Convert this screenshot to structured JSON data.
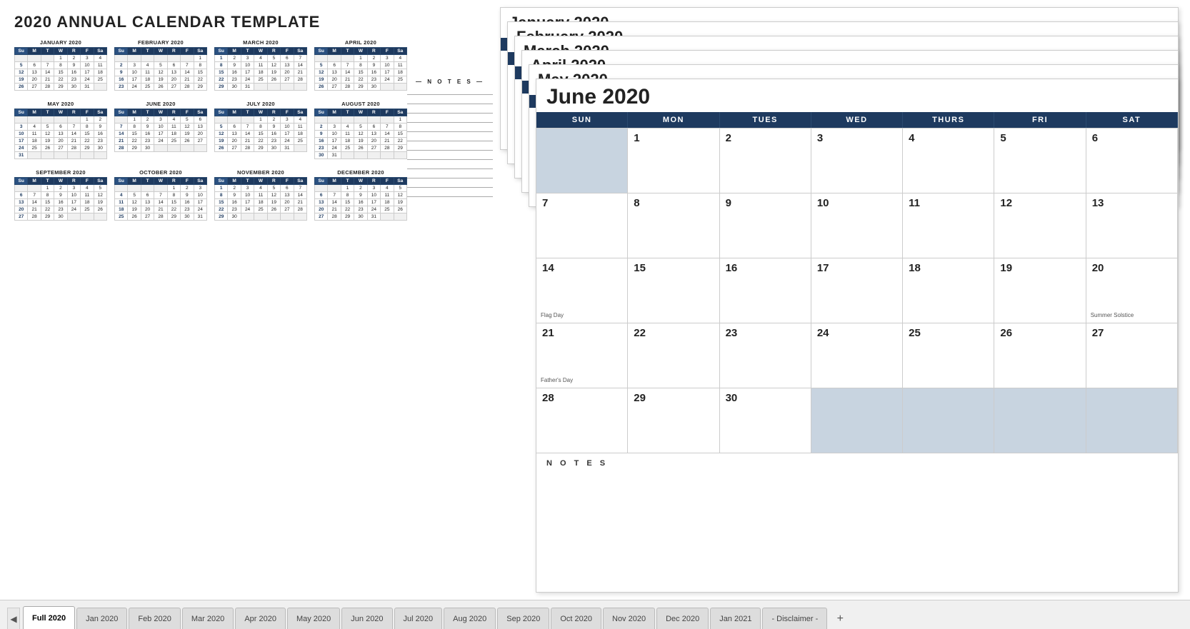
{
  "page": {
    "title": "2020 ANNUAL CALENDAR TEMPLATE"
  },
  "mini_calendars": [
    {
      "name": "JANUARY 2020",
      "headers": [
        "Su",
        "M",
        "T",
        "W",
        "R",
        "F",
        "Sa"
      ],
      "rows": [
        [
          "",
          "",
          "",
          "1",
          "2",
          "3",
          "4"
        ],
        [
          "5",
          "6",
          "7",
          "8",
          "9",
          "10",
          "11"
        ],
        [
          "12",
          "13",
          "14",
          "15",
          "16",
          "17",
          "18"
        ],
        [
          "19",
          "20",
          "21",
          "22",
          "23",
          "24",
          "25"
        ],
        [
          "26",
          "27",
          "28",
          "29",
          "30",
          "31",
          ""
        ]
      ]
    },
    {
      "name": "FEBRUARY 2020",
      "headers": [
        "Su",
        "M",
        "T",
        "W",
        "R",
        "F",
        "Sa"
      ],
      "rows": [
        [
          "",
          "",
          "",
          "",
          "",
          "",
          "1"
        ],
        [
          "2",
          "3",
          "4",
          "5",
          "6",
          "7",
          "8"
        ],
        [
          "9",
          "10",
          "11",
          "12",
          "13",
          "14",
          "15"
        ],
        [
          "16",
          "17",
          "18",
          "19",
          "20",
          "21",
          "22"
        ],
        [
          "23",
          "24",
          "25",
          "26",
          "27",
          "28",
          "29"
        ]
      ]
    },
    {
      "name": "MARCH 2020",
      "headers": [
        "Su",
        "M",
        "T",
        "W",
        "R",
        "F",
        "Sa"
      ],
      "rows": [
        [
          "1",
          "2",
          "3",
          "4",
          "5",
          "6",
          "7"
        ],
        [
          "8",
          "9",
          "10",
          "11",
          "12",
          "13",
          "14"
        ],
        [
          "15",
          "16",
          "17",
          "18",
          "19",
          "20",
          "21"
        ],
        [
          "22",
          "23",
          "24",
          "25",
          "26",
          "27",
          "28"
        ],
        [
          "29",
          "30",
          "31",
          "",
          "",
          "",
          ""
        ]
      ]
    },
    {
      "name": "APRIL 2020",
      "headers": [
        "Su",
        "M",
        "T",
        "W",
        "R",
        "F",
        "Sa"
      ],
      "rows": [
        [
          "",
          "",
          "",
          "1",
          "2",
          "3",
          "4"
        ],
        [
          "5",
          "6",
          "7",
          "8",
          "9",
          "10",
          "11"
        ],
        [
          "12",
          "13",
          "14",
          "15",
          "16",
          "17",
          "18"
        ],
        [
          "19",
          "20",
          "21",
          "22",
          "23",
          "24",
          "25"
        ],
        [
          "26",
          "27",
          "28",
          "29",
          "30",
          "",
          ""
        ]
      ]
    },
    {
      "name": "MAY 2020",
      "headers": [
        "Su",
        "M",
        "T",
        "W",
        "R",
        "F",
        "Sa"
      ],
      "rows": [
        [
          "",
          "",
          "",
          "",
          "",
          "1",
          "2"
        ],
        [
          "3",
          "4",
          "5",
          "6",
          "7",
          "8",
          "9"
        ],
        [
          "10",
          "11",
          "12",
          "13",
          "14",
          "15",
          "16"
        ],
        [
          "17",
          "18",
          "19",
          "20",
          "21",
          "22",
          "23"
        ],
        [
          "24",
          "25",
          "26",
          "27",
          "28",
          "29",
          "30"
        ],
        [
          "31",
          "",
          "",
          "",
          "",
          "",
          ""
        ]
      ]
    },
    {
      "name": "JUNE 2020",
      "headers": [
        "Su",
        "M",
        "T",
        "W",
        "R",
        "F",
        "Sa"
      ],
      "rows": [
        [
          "",
          "1",
          "2",
          "3",
          "4",
          "5",
          "6"
        ],
        [
          "7",
          "8",
          "9",
          "10",
          "11",
          "12",
          "13"
        ],
        [
          "14",
          "15",
          "16",
          "17",
          "18",
          "19",
          "20"
        ],
        [
          "21",
          "22",
          "23",
          "24",
          "25",
          "26",
          "27"
        ],
        [
          "28",
          "29",
          "30",
          "",
          "",
          "",
          ""
        ]
      ]
    },
    {
      "name": "JULY 2020",
      "headers": [
        "Su",
        "M",
        "T",
        "W",
        "R",
        "F",
        "Sa"
      ],
      "rows": [
        [
          "",
          "",
          "",
          "1",
          "2",
          "3",
          "4"
        ],
        [
          "5",
          "6",
          "7",
          "8",
          "9",
          "10",
          "11"
        ],
        [
          "12",
          "13",
          "14",
          "15",
          "16",
          "17",
          "18"
        ],
        [
          "19",
          "20",
          "21",
          "22",
          "23",
          "24",
          "25"
        ],
        [
          "26",
          "27",
          "28",
          "29",
          "30",
          "31",
          ""
        ]
      ]
    },
    {
      "name": "AUGUST 2020",
      "headers": [
        "Su",
        "M",
        "T",
        "W",
        "R",
        "F",
        "Sa"
      ],
      "rows": [
        [
          "",
          "",
          "",
          "",
          "",
          "",
          "1"
        ],
        [
          "2",
          "3",
          "4",
          "5",
          "6",
          "7",
          "8"
        ],
        [
          "9",
          "10",
          "11",
          "12",
          "13",
          "14",
          "15"
        ],
        [
          "16",
          "17",
          "18",
          "19",
          "20",
          "21",
          "22"
        ],
        [
          "23",
          "24",
          "25",
          "26",
          "27",
          "28",
          "29"
        ],
        [
          "30",
          "31",
          "",
          "",
          "",
          "",
          ""
        ]
      ]
    },
    {
      "name": "SEPTEMBER 2020",
      "headers": [
        "Su",
        "M",
        "T",
        "W",
        "R",
        "F",
        "Sa"
      ],
      "rows": [
        [
          "",
          "",
          "1",
          "2",
          "3",
          "4",
          "5"
        ],
        [
          "6",
          "7",
          "8",
          "9",
          "10",
          "11",
          "12"
        ],
        [
          "13",
          "14",
          "15",
          "16",
          "17",
          "18",
          "19"
        ],
        [
          "20",
          "21",
          "22",
          "23",
          "24",
          "25",
          "26"
        ],
        [
          "27",
          "28",
          "29",
          "30",
          "",
          "",
          ""
        ]
      ]
    },
    {
      "name": "OCTOBER 2020",
      "headers": [
        "Su",
        "M",
        "T",
        "W",
        "R",
        "F",
        "Sa"
      ],
      "rows": [
        [
          "",
          "",
          "",
          "",
          "1",
          "2",
          "3"
        ],
        [
          "4",
          "5",
          "6",
          "7",
          "8",
          "9",
          "10"
        ],
        [
          "11",
          "12",
          "13",
          "14",
          "15",
          "16",
          "17"
        ],
        [
          "18",
          "19",
          "20",
          "21",
          "22",
          "23",
          "24"
        ],
        [
          "25",
          "26",
          "27",
          "28",
          "29",
          "30",
          "31"
        ]
      ]
    },
    {
      "name": "NOVEMBER 2020",
      "headers": [
        "Su",
        "M",
        "T",
        "W",
        "R",
        "F",
        "Sa"
      ],
      "rows": [
        [
          "1",
          "2",
          "3",
          "4",
          "5",
          "6",
          "7"
        ],
        [
          "8",
          "9",
          "10",
          "11",
          "12",
          "13",
          "14"
        ],
        [
          "15",
          "16",
          "17",
          "18",
          "19",
          "20",
          "21"
        ],
        [
          "22",
          "23",
          "24",
          "25",
          "26",
          "27",
          "28"
        ],
        [
          "29",
          "30",
          "",
          "",
          "",
          "",
          ""
        ]
      ]
    },
    {
      "name": "DECEMBER 2020",
      "headers": [
        "Su",
        "M",
        "T",
        "W",
        "R",
        "F",
        "Sa"
      ],
      "rows": [
        [
          "",
          "",
          "1",
          "2",
          "3",
          "4",
          "5"
        ],
        [
          "6",
          "7",
          "8",
          "9",
          "10",
          "11",
          "12"
        ],
        [
          "13",
          "14",
          "15",
          "16",
          "17",
          "18",
          "19"
        ],
        [
          "20",
          "21",
          "22",
          "23",
          "24",
          "25",
          "26"
        ],
        [
          "27",
          "28",
          "29",
          "30",
          "31",
          "",
          ""
        ]
      ]
    }
  ],
  "notes_label": "— N O T E S —",
  "stacked_months": [
    "January 2020",
    "February 2020",
    "March 2020",
    "April 2020",
    "May 2020"
  ],
  "front_month": "June 2020",
  "front_headers": [
    "SUN",
    "MON",
    "TUES",
    "WED",
    "THURS",
    "FRI",
    "SAT"
  ],
  "front_rows": [
    [
      {
        "day": "",
        "inactive": true
      },
      {
        "day": "1",
        "inactive": false
      },
      {
        "day": "2",
        "inactive": false
      },
      {
        "day": "3",
        "inactive": false
      },
      {
        "day": "4",
        "inactive": false
      },
      {
        "day": "5",
        "inactive": false
      },
      {
        "day": "6",
        "inactive": false
      }
    ],
    [
      {
        "day": "7",
        "inactive": false
      },
      {
        "day": "8",
        "inactive": false
      },
      {
        "day": "9",
        "inactive": false
      },
      {
        "day": "10",
        "inactive": false
      },
      {
        "day": "11",
        "inactive": false
      },
      {
        "day": "12",
        "inactive": false
      },
      {
        "day": "13",
        "inactive": false
      }
    ],
    [
      {
        "day": "14",
        "inactive": false
      },
      {
        "day": "15",
        "inactive": false
      },
      {
        "day": "16",
        "inactive": false
      },
      {
        "day": "17",
        "inactive": false
      },
      {
        "day": "18",
        "inactive": false
      },
      {
        "day": "19",
        "inactive": false
      },
      {
        "day": "20",
        "inactive": false,
        "holiday": "Summer Solstice"
      }
    ],
    [
      {
        "day": "21",
        "inactive": false
      },
      {
        "day": "22",
        "inactive": false
      },
      {
        "day": "23",
        "inactive": false
      },
      {
        "day": "24",
        "inactive": false
      },
      {
        "day": "25",
        "inactive": false
      },
      {
        "day": "26",
        "inactive": false
      },
      {
        "day": "27",
        "inactive": false
      }
    ],
    [
      {
        "day": "28",
        "inactive": false,
        "holiday": "Father's Day"
      },
      {
        "day": "29",
        "inactive": false
      },
      {
        "day": "30",
        "inactive": false
      },
      {
        "day": "",
        "inactive": true
      },
      {
        "day": "",
        "inactive": true
      },
      {
        "day": "",
        "inactive": true
      },
      {
        "day": "",
        "inactive": true
      }
    ]
  ],
  "row14_holidays": [
    "",
    "",
    "",
    "",
    "",
    "",
    ""
  ],
  "flag_day_cell": "14",
  "fathers_day_cell": "21",
  "notes_bottom_label": "N O T E S",
  "tabs": [
    {
      "label": "Full 2020",
      "active": true
    },
    {
      "label": "Jan 2020",
      "active": false
    },
    {
      "label": "Feb 2020",
      "active": false
    },
    {
      "label": "Mar 2020",
      "active": false
    },
    {
      "label": "Apr 2020",
      "active": false
    },
    {
      "label": "May 2020",
      "active": false
    },
    {
      "label": "Jun 2020",
      "active": false
    },
    {
      "label": "Jul 2020",
      "active": false
    },
    {
      "label": "Aug 2020",
      "active": false
    },
    {
      "label": "Sep 2020",
      "active": false
    },
    {
      "label": "Oct 2020",
      "active": false
    },
    {
      "label": "Nov 2020",
      "active": false
    },
    {
      "label": "Dec 2020",
      "active": false
    },
    {
      "label": "Jan 2021",
      "active": false
    },
    {
      "label": "- Disclaimer -",
      "active": false
    }
  ]
}
